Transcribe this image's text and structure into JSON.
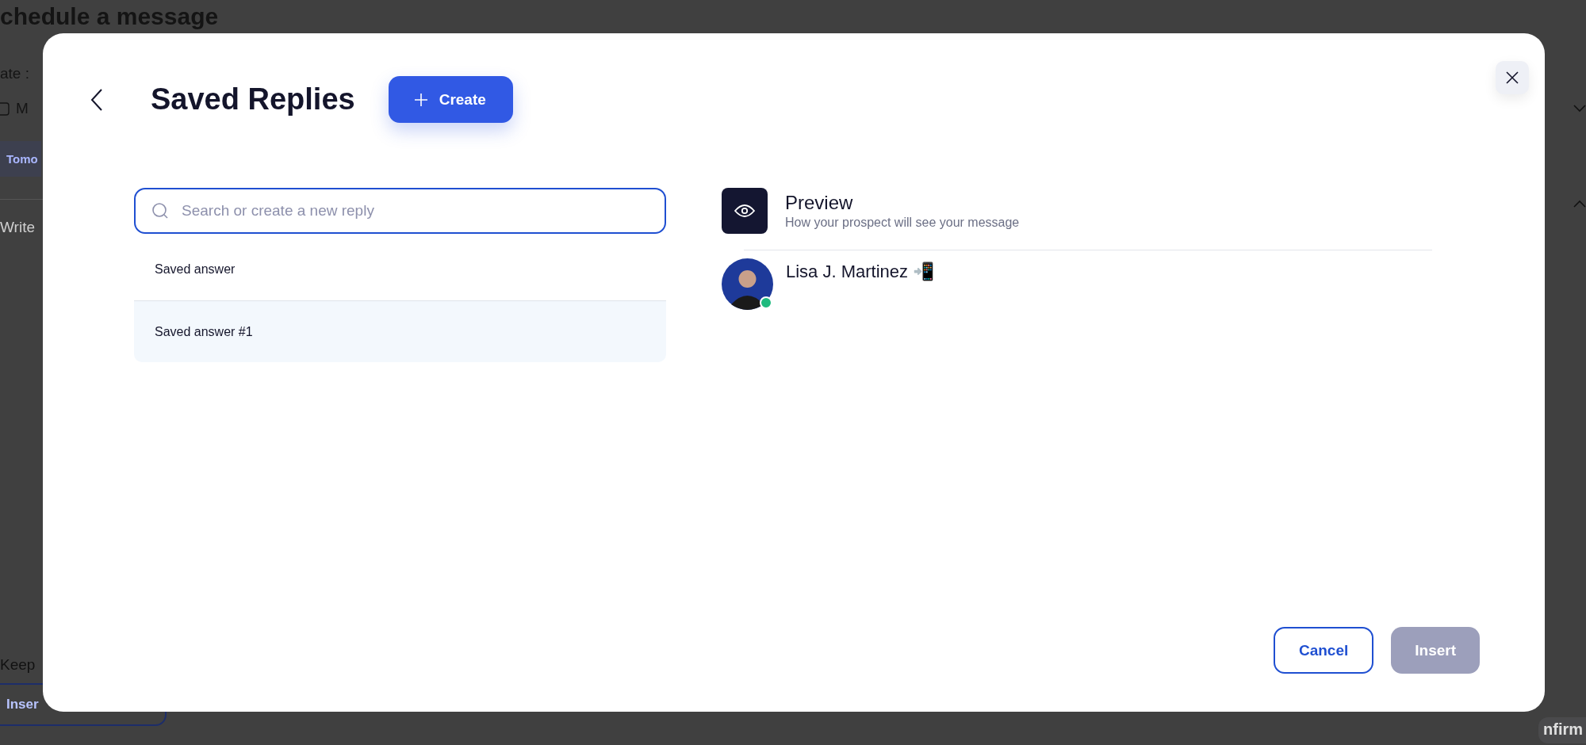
{
  "background": {
    "title": "chedule a message",
    "date_label": "ate :",
    "date_value": "M",
    "chip": "Tomo",
    "editor_placeholder": "Write",
    "option_label": "Keep",
    "insert_button": "Inser",
    "confirm_button": "nfirm"
  },
  "modal": {
    "title": "Saved Replies",
    "create_button": "Create",
    "search": {
      "placeholder": "Search or create a new reply"
    },
    "replies": [
      {
        "label": "Saved answer",
        "selected": false
      },
      {
        "label": "Saved answer #1",
        "selected": true
      }
    ],
    "preview": {
      "title": "Preview",
      "subtitle": "How your prospect will see your message",
      "contact": {
        "name": "Lisa J. Martinez 📲",
        "online": true
      }
    },
    "buttons": [
      {
        "label": "Cancel",
        "disabled": false,
        "kind": "outline"
      },
      {
        "label": "Insert",
        "disabled": true,
        "kind": "primary"
      }
    ]
  }
}
